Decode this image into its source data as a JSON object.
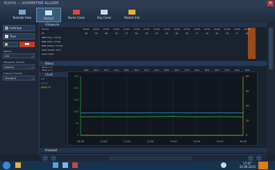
{
  "window": {
    "title": "ELEXIS — DOSIMETRIE ALLGEM"
  },
  "tabs": [
    {
      "label": "Bedside View",
      "icon": "monitor-icon",
      "active": false
    },
    {
      "label": "Verlauf",
      "icon": "chart-icon",
      "active": true
    },
    {
      "label": "Nurse Cares",
      "icon": "cross-icon",
      "active": false
    },
    {
      "label": "Day Cares",
      "icon": "bottle-icon",
      "active": false
    },
    {
      "label": "Patient Info",
      "icon": "person-icon",
      "active": false
    }
  ],
  "left_panel": {
    "buttons": [
      {
        "label": "Aufträge",
        "icon": "pen-icon"
      },
      {
        "label": "Teve",
        "icon": "people-icon"
      }
    ],
    "fields": [
      {
        "label": "Modus",
        "value": "Alle"
      },
      {
        "label": "Messwert Einheit",
        "value": "Normal"
      },
      {
        "label": "Graphic Einheit",
        "value": "Standard"
      }
    ]
  },
  "sections": {
    "vitals": "Vitalwerte",
    "balance": "Bilanz",
    "chart": "Chart",
    "bottom": "Protokoll"
  },
  "vitals_rows": [
    "VITALS",
    "HF",
    "NIBP (Sys), mmHg",
    "NIBP (Dia), mmHg",
    "NIBP (Mean), mmHg",
    "SpO2 (Pleth), bpm",
    "SpO2, Pleth"
  ],
  "time_headers": [
    "09:00",
    "09:00",
    "09:30",
    "10:00",
    "10:30",
    "11:00",
    "11:30",
    "12:00",
    "12:30",
    "13:00",
    "13:30",
    "14:00",
    "14:30",
    "15:00",
    "15:30",
    "16:00",
    "16:30"
  ],
  "hr_values": [
    "78",
    "76",
    "80",
    "79",
    "77",
    "81",
    "78",
    "76",
    "79",
    "80",
    "78",
    "77",
    "79",
    "81",
    "78",
    "77",
    "80"
  ],
  "balance_rows": [
    "Temp 1 °C",
    "Temp 2 °C"
  ],
  "balance_values": [
    "36.8",
    "36.9",
    "37.0",
    "36.9",
    "36.8",
    "36.9",
    "37.0",
    "36.9",
    "36.8",
    "36.9",
    "37.0",
    "36.9",
    "36.8",
    "36.9",
    "37.0",
    "36.9",
    "36.8"
  ],
  "chart_data": {
    "type": "line",
    "x": [
      "09:00",
      "10:00",
      "11:00",
      "12:00",
      "13:00",
      "14:00",
      "15:00",
      "16:00"
    ],
    "series": [
      {
        "name": "HR",
        "color": "#2ec24a",
        "values": [
          78,
          79,
          78,
          79,
          80,
          78,
          79,
          78
        ]
      },
      {
        "name": "SpO2 %",
        "color": "#1f8fd8",
        "values": [
          95,
          95,
          95,
          95,
          95,
          95,
          95,
          95
        ]
      },
      {
        "name": "RR",
        "color": "#e0c21a",
        "values": [
          0,
          0,
          0,
          0,
          0,
          0,
          0,
          0
        ]
      }
    ],
    "left_ticks": [
      "250",
      "200",
      "150",
      "100",
      "50",
      "0"
    ],
    "right_ticks": [
      "40",
      "30",
      "20",
      "10",
      "0"
    ]
  },
  "chart_legend": [
    "HR",
    "SpO2",
    "SpO2 %"
  ],
  "taskbar": {
    "time": "17:47",
    "date": "25.06.2013"
  }
}
